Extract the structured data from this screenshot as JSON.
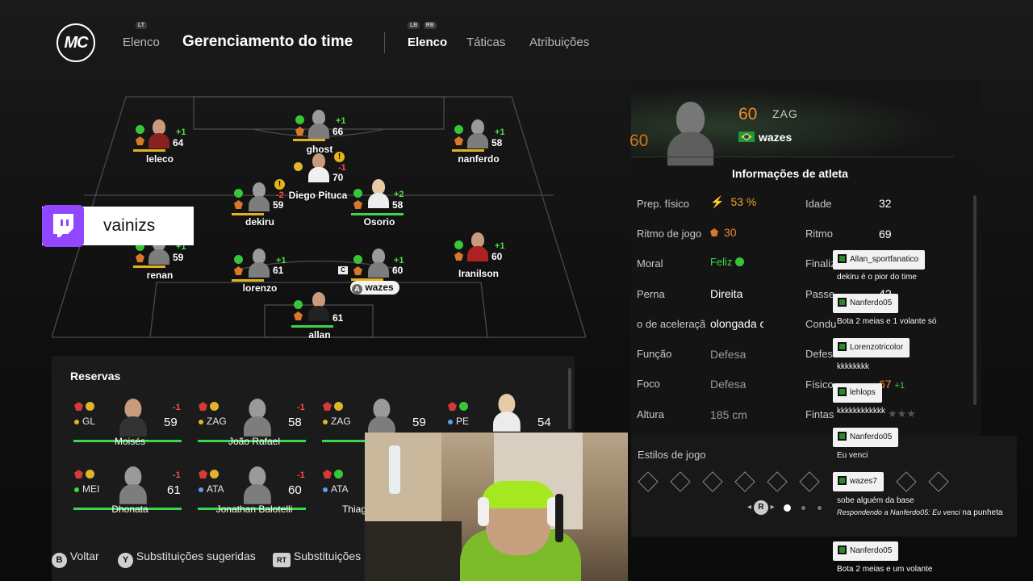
{
  "header": {
    "logo": "MC",
    "squad_label": "Elenco",
    "lt_hint": "LT",
    "title": "Gerenciamento do time",
    "lb_hint": "LB",
    "rb_hint": "RB",
    "tabs": [
      {
        "label": "Elenco",
        "active": true
      },
      {
        "label": "Táticas",
        "active": false
      },
      {
        "label": "Atribuições",
        "active": false
      }
    ]
  },
  "twitch": {
    "name": "vainizs"
  },
  "pitch": {
    "players": [
      {
        "name": "leleco",
        "rating": "64",
        "delta": "+1",
        "captain": false
      },
      {
        "name": "ghost",
        "rating": "66",
        "delta": "+1"
      },
      {
        "name": "nanferdo",
        "rating": "58",
        "delta": "+1"
      },
      {
        "name": "Diego Pituca",
        "rating": "70",
        "delta": "-1"
      },
      {
        "name": "dekiru",
        "rating": "59",
        "delta": "-2"
      },
      {
        "name": "Osorio",
        "rating": "58",
        "delta": "+2"
      },
      {
        "name": "renan",
        "rating": "59",
        "delta": "+1"
      },
      {
        "name": "lorenzo",
        "rating": "61",
        "delta": "+1"
      },
      {
        "name": "wazes",
        "rating": "60",
        "delta": "+1",
        "badge": "A",
        "captain_mark": "C"
      },
      {
        "name": "Iranilson",
        "rating": "60",
        "delta": "+1"
      },
      {
        "name": "allan",
        "rating": "61",
        "delta": ""
      }
    ]
  },
  "reserves": {
    "title": "Reservas",
    "players": [
      {
        "name": "Moisés",
        "pos": "GL",
        "rating": "59",
        "delta": "-1",
        "dot": "#e0b52a"
      },
      {
        "name": "João Rafael",
        "pos": "ZAG",
        "rating": "58",
        "delta": "-1",
        "dot": "#e0b52a"
      },
      {
        "name": "",
        "pos": "ZAG",
        "rating": "59",
        "delta": "",
        "dot": "#e0b52a"
      },
      {
        "name": "",
        "pos": "PE",
        "rating": "54",
        "delta": "",
        "dot": "#5aa0e8"
      },
      {
        "name": "Dhonata",
        "pos": "MEI",
        "rating": "61",
        "delta": "-1",
        "dot": "#3bd64a"
      },
      {
        "name": "Jonathan Balotelli",
        "pos": "ATA",
        "rating": "60",
        "delta": "-1",
        "dot": "#5aa0e8"
      },
      {
        "name": "Thiag",
        "pos": "ATA",
        "rating": "",
        "delta": "",
        "dot": "#5aa0e8"
      }
    ]
  },
  "athlete": {
    "overall": "60",
    "overall_big": "60",
    "position": "ZAG",
    "name": "wazes",
    "section_title": "Informações de atleta",
    "left": [
      {
        "label": "Prep. físico",
        "value": "53 %"
      },
      {
        "label": "Ritmo de jogo",
        "value": "30"
      },
      {
        "label": "Moral",
        "value": "Feliz"
      },
      {
        "label": "Perna",
        "value": "Direita"
      },
      {
        "label": "o de aceleraçã",
        "value": "olongada c"
      },
      {
        "label": "Função",
        "value": "Defesa"
      },
      {
        "label": "Foco",
        "value": "Defesa"
      },
      {
        "label": "Altura",
        "value": "185 cm"
      }
    ],
    "right": [
      {
        "label": "Idade",
        "value": "32"
      },
      {
        "label": "Ritmo",
        "value": "69"
      },
      {
        "label": "Finaliz",
        "value": ""
      },
      {
        "label": "Passe",
        "value": "4?"
      },
      {
        "label": "Condu",
        "value": ""
      },
      {
        "label": "Defes",
        "value": ""
      },
      {
        "label": "Físico",
        "value": "67",
        "delta": "+1"
      },
      {
        "label": "Fintas",
        "value": "★★★"
      }
    ],
    "play_styles_label": "Estilos de jogo",
    "pager_button": "R"
  },
  "chat": [
    {
      "user": "Allan_sportfanatico",
      "text": "dekiru é o pior do time"
    },
    {
      "user": "Nanferdo05",
      "text": "Bota 2 meias e 1 volante só"
    },
    {
      "user": "Lorenzotricolor",
      "text": "kkkkkkkk"
    },
    {
      "user": "lehlops",
      "text": "kkkkkkkkkkkk"
    },
    {
      "user": "Nanferdo05",
      "text": "Eu venci"
    },
    {
      "user": "wazes7",
      "text": "sobe alguém da base",
      "reply": "Respondendo a Nanferdo05: Eu venci",
      "text2": "na punheta"
    },
    {
      "user": "Nanferdo05",
      "text": "Bota 2 meias e um volante"
    }
  ],
  "footer": {
    "hints": [
      {
        "button": "B",
        "label": "Voltar"
      },
      {
        "button": "Y",
        "label": "Substituições sugeridas"
      },
      {
        "button": "RT",
        "label": "Substituições"
      }
    ]
  },
  "colors": {
    "accent_orange": "#f08a2a",
    "positive": "#3bd64a",
    "negative": "#ff4d4d",
    "twitch": "#9146ff"
  }
}
